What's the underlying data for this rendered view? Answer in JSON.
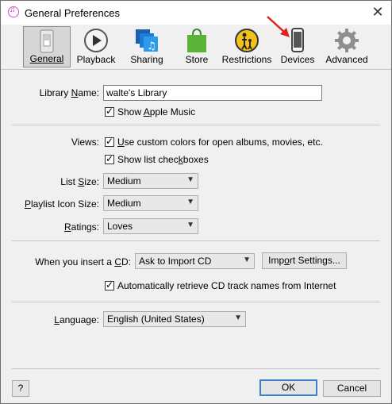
{
  "window": {
    "title": "General Preferences",
    "close_glyph": "✕"
  },
  "toolbar": {
    "items": [
      {
        "label": "General",
        "icon": "general-switch-icon",
        "selected": true
      },
      {
        "label": "Playback",
        "icon": "play-icon"
      },
      {
        "label": "Sharing",
        "icon": "sharing-music-icon"
      },
      {
        "label": "Store",
        "icon": "shopping-bag-icon"
      },
      {
        "label": "Restrictions",
        "icon": "restrictions-parent-child-icon"
      },
      {
        "label": "Devices",
        "icon": "phone-device-icon"
      },
      {
        "label": "Advanced",
        "icon": "gear-icon"
      }
    ]
  },
  "library": {
    "label_pre": "Library ",
    "label_u": "N",
    "label_post": "ame:",
    "name_value": "walte's Library",
    "show_apple_music_pre": "Show ",
    "show_apple_music_u": "A",
    "show_apple_music_post": "pple Music",
    "show_apple_music_checked": true
  },
  "views": {
    "label": "Views:",
    "custom_colors_pre": "",
    "custom_colors_u": "U",
    "custom_colors_post": "se custom colors for open albums, movies, etc.",
    "custom_colors_checked": true,
    "show_checkboxes_pre": "Show list chec",
    "show_checkboxes_u": "k",
    "show_checkboxes_post": "boxes",
    "show_checkboxes_checked": true
  },
  "list_size": {
    "label_pre": "List ",
    "label_u": "S",
    "label_post": "ize:",
    "value": "Medium"
  },
  "playlist_icon_size": {
    "label_pre": "",
    "label_u": "P",
    "label_post": "laylist Icon Size:",
    "value": "Medium"
  },
  "ratings": {
    "label_pre": "",
    "label_u": "R",
    "label_post": "atings:",
    "value": "Loves"
  },
  "cd": {
    "label_pre": "When you insert a ",
    "label_u": "C",
    "label_post": "D:",
    "value": "Ask to Import CD",
    "import_btn_pre": "Imp",
    "import_btn_u": "o",
    "import_btn_post": "rt Settings...",
    "auto_retrieve": "Automatically retrieve CD track names from Internet",
    "auto_retrieve_checked": true
  },
  "language": {
    "label_pre": "",
    "label_u": "L",
    "label_post": "anguage:",
    "value": "English (United States)"
  },
  "footer": {
    "help": "?",
    "ok": "OK",
    "cancel": "Cancel"
  },
  "colors": {
    "accent": "#3c7fd1",
    "annotation_arrow": "#e02020"
  }
}
